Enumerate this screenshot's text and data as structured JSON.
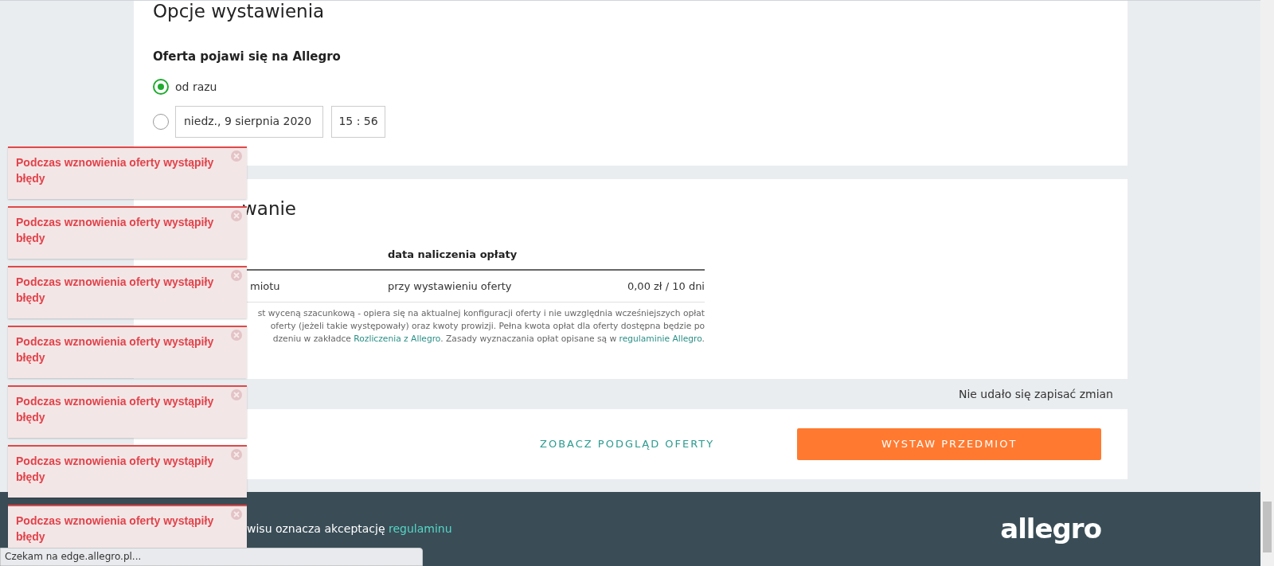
{
  "listing_options": {
    "title": "Opcje wystawienia",
    "subtitle": "Oferta pojawi się na Allegro",
    "options": [
      {
        "kind": "label",
        "selected": true,
        "label": "od razu"
      },
      {
        "kind": "datetime",
        "selected": false,
        "date": "niedz., 9 sierpnia 2020",
        "time": "15 : 56"
      }
    ]
  },
  "summary": {
    "title": "wanie",
    "table": {
      "header": {
        "column_2": "data naliczenia opłaty"
      },
      "rows": [
        {
          "column_1": "miotu",
          "column_2": "przy wystawieniu oferty",
          "column_3": "0,00 zł / 10 dni"
        }
      ]
    },
    "note_lines": [
      [
        {
          "text": "st wyceną szacunkową - opiera się na aktualnej konfiguracji oferty i nie uwzględnia wcześniejszych opłat"
        }
      ],
      [
        {
          "text": "oferty (jeżeli takie występowały) oraz kwoty prowizji. Pełna kwota opłat dla oferty dostępna będzie po"
        }
      ],
      [
        {
          "text": "dzeniu w zakładce "
        },
        {
          "text": "Rozliczenia z Allegro",
          "link": true
        },
        {
          "text": ". Zasady wyznaczania opłat opisane są w "
        },
        {
          "text": "regulaminie Allegro",
          "link": true
        },
        {
          "text": "."
        }
      ]
    ]
  },
  "save_status": "Nie udało się zapisać zmian",
  "buttons": [
    {
      "kind": "link",
      "label": "ZOBACZ PODGLĄD OFERTY"
    },
    {
      "kind": "primary",
      "label": "WYSTAW PRZEDMIOT"
    }
  ],
  "footer": {
    "text": [
      {
        "text": "wisu oznacza akceptację "
      },
      {
        "text": "regulaminu",
        "link": true
      }
    ],
    "logo": "allegro"
  },
  "toasts": [
    {
      "message": "Podczas wznowienia oferty wystąpiły błędy"
    },
    {
      "message": "Podczas wznowienia oferty wystąpiły błędy"
    },
    {
      "message": "Podczas wznowienia oferty wystąpiły błędy"
    },
    {
      "message": "Podczas wznowienia oferty wystąpiły błędy"
    },
    {
      "message": "Podczas wznowienia oferty wystąpiły błędy"
    },
    {
      "message": "Podczas wznowienia oferty wystąpiły błędy"
    },
    {
      "message": "Podczas wznowienia oferty wystąpiły błędy"
    }
  ],
  "status_bar": "Czekam na edge.allegro.pl..."
}
